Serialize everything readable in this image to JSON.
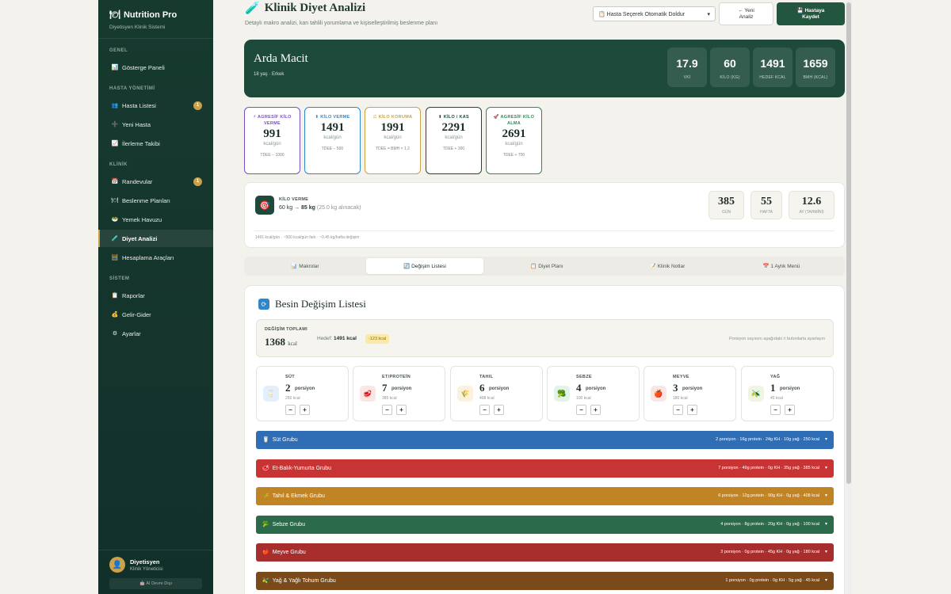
{
  "brand": {
    "title": "Nutrition Pro",
    "subtitle": "Diyetisyen Klinik Sistemi"
  },
  "nav": {
    "sections": [
      "GENEL",
      "HASTA YÖNETİMİ",
      "KLİNİK",
      "SİSTEM"
    ],
    "items": [
      {
        "label": "Gösterge Paneli",
        "icon": "chart-icon"
      },
      {
        "label": "Hasta Listesi",
        "icon": "people-icon",
        "badge": "1"
      },
      {
        "label": "Yeni Hasta",
        "icon": "plus-icon"
      },
      {
        "label": "İlerleme Takibi",
        "icon": "progress-icon"
      },
      {
        "label": "Randevular",
        "icon": "calendar-icon",
        "badge": "1"
      },
      {
        "label": "Beslenme Planları",
        "icon": "plan-icon"
      },
      {
        "label": "Yemek Havuzu",
        "icon": "food-icon"
      },
      {
        "label": "Diyet Analizi",
        "icon": "analysis-icon"
      },
      {
        "label": "Hesaplama Araçları",
        "icon": "calculator-icon"
      },
      {
        "label": "Raporlar",
        "icon": "report-icon"
      },
      {
        "label": "Gelir-Gider",
        "icon": "money-icon"
      },
      {
        "label": "Ayarlar",
        "icon": "gear-icon"
      }
    ]
  },
  "sidebar_user": {
    "name": "Diyetisyen",
    "role": "Klinik Yöneticisi",
    "ai_status": "AI Devre Dışı"
  },
  "header": {
    "title": "Klinik Diyet Analizi",
    "subtitle": "Detaylı makro analizi, kan tahlili yorumlama ve kişiselleştirilmiş beslenme planı",
    "patient_select": "Hasta Seçerek Otomatik Doldur",
    "new_button": "← Yeni Analiz",
    "save_button": "Hastaya Kaydet"
  },
  "patient": {
    "name": "Arda Macit",
    "info": "18 yaş · Erkek",
    "stats": [
      {
        "value": "17.9",
        "label": "VKİ"
      },
      {
        "value": "60",
        "label": "KİLO (KG)"
      },
      {
        "value": "1491",
        "label": "HEDEF KCAL"
      },
      {
        "value": "1659",
        "label": "BMH (KCAL)"
      }
    ]
  },
  "goals": [
    {
      "title": "⚡ AGRESİF KİLO VERME",
      "value": "991",
      "unit": "kcal/gün",
      "formula": "TDEE − 1000",
      "color": "#7b4fc2"
    },
    {
      "title": "⬇ KİLO VERME",
      "value": "1491",
      "unit": "kcal/gün",
      "formula": "TDEE − 500",
      "color": "#2f86c9"
    },
    {
      "title": "⚖ KİLO KORUMA",
      "value": "1991",
      "unit": "kcal/gün",
      "formula": "TDEE = BMH × 1.2",
      "color": "#c9a24a"
    },
    {
      "title": "⬆ KİLO / KAS",
      "value": "2291",
      "unit": "kcal/gün",
      "formula": "TDEE + 300",
      "color": "#1e4a3c"
    },
    {
      "title": "🚀 AGRESİF KİLO ALMA",
      "value": "2691",
      "unit": "kcal/gün",
      "formula": "TDEE + 700",
      "color": "#2e8a57"
    }
  ],
  "target": {
    "label": "KİLO VERME",
    "from": "60 kg →",
    "to": "85 kg",
    "note": "(25.0 kg alınacak)",
    "boxes": [
      {
        "value": "385",
        "label": "GÜN"
      },
      {
        "value": "55",
        "label": "HAFTA"
      },
      {
        "value": "12.6",
        "label": "AY (TAHMİNİ)"
      }
    ],
    "footnote": "1491 kcal/gün · ~500 kcal/gün fark · ~0.45 kg/hafta değişim"
  },
  "tabs": [
    "📊 Makrolar",
    "🔄 Değişim Listesi",
    "📋 Diyet Planı",
    "📝 Klinik Notlar",
    "📅 1 Aylık Menü"
  ],
  "exchange": {
    "title": "Besin Değişim Listesi",
    "summary_label": "DEĞİŞİM TOPLAMI",
    "summary_value": "1368",
    "summary_unit": "kcal",
    "target_label": "Hedef:",
    "target_value": "1491 kcal",
    "diff": "-123 kcal",
    "hint": "Porsiyon sayısını aşağıdaki ± butonlarla ayarlayın",
    "groups": [
      {
        "name": "SÜT",
        "portions": "2",
        "unit": "porsiyon",
        "kcal": "250 kcal",
        "icon": "milk-icon",
        "glyph": "🥛",
        "bg": "#e3f0fb"
      },
      {
        "name": "ET/PROTEİN",
        "portions": "7",
        "unit": "porsiyon",
        "kcal": "385 kcal",
        "icon": "meat-icon",
        "glyph": "🥩",
        "bg": "#fbe6e6"
      },
      {
        "name": "TAHIL",
        "portions": "6",
        "unit": "porsiyon",
        "kcal": "408 kcal",
        "icon": "grain-icon",
        "glyph": "🌾",
        "bg": "#fbf1dc"
      },
      {
        "name": "SEBZE",
        "portions": "4",
        "unit": "porsiyon",
        "kcal": "100 kcal",
        "icon": "vegetable-icon",
        "glyph": "🥦",
        "bg": "#e2f3e8"
      },
      {
        "name": "MEYVE",
        "portions": "3",
        "unit": "porsiyon",
        "kcal": "180 kcal",
        "icon": "fruit-icon",
        "glyph": "🍎",
        "bg": "#fbe6e6"
      },
      {
        "name": "YAĞ",
        "portions": "1",
        "unit": "porsiyon",
        "kcal": "45 kcal",
        "icon": "oil-icon",
        "glyph": "🫒",
        "bg": "#eef5e2"
      }
    ],
    "bars": [
      {
        "name": "Süt Grubu",
        "icon": "milk-icon",
        "glyph": "🥛",
        "summary": "2 porsiyon · 16g protein · 24g KH · 10g yağ · 250 kcal",
        "color": "#2f6db5"
      },
      {
        "name": "Et-Balık-Yumurta Grubu",
        "icon": "meat-icon",
        "glyph": "🥩",
        "summary": "7 porsiyon · 49g protein · 0g KH · 35g yağ · 385 kcal",
        "color": "#c83434"
      },
      {
        "name": "Tahıl & Ekmek Grubu",
        "icon": "grain-icon",
        "glyph": "🌾",
        "summary": "6 porsiyon · 12g protein · 90g KH · 0g yağ · 408 kcal",
        "color": "#c08424"
      },
      {
        "name": "Sebze Grubu",
        "icon": "vegetable-icon",
        "glyph": "🥦",
        "summary": "4 porsiyon · 8g protein · 20g KH · 0g yağ · 100 kcal",
        "color": "#2b6a4a"
      },
      {
        "name": "Meyve Grubu",
        "icon": "fruit-icon",
        "glyph": "🍎",
        "summary": "3 porsiyon · 0g protein · 45g KH · 0g yağ · 180 kcal",
        "color": "#a82e2e"
      },
      {
        "name": "Yağ & Yağlı Tohum Grubu",
        "icon": "oil-icon",
        "glyph": "🫒",
        "summary": "1 porsiyon · 0g protein · 0g KH · 5g yağ · 45 kcal",
        "color": "#7a4a1a"
      }
    ]
  }
}
